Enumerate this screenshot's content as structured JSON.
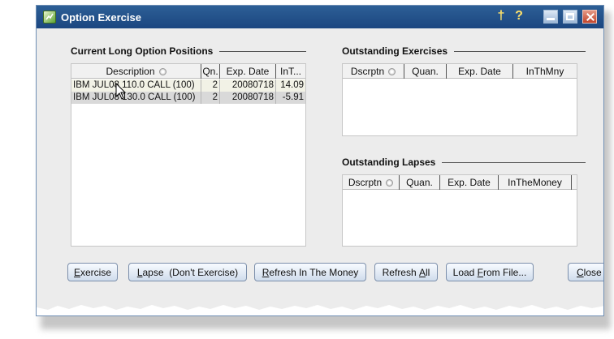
{
  "window": {
    "title": "Option Exercise"
  },
  "titlebar": {
    "pin_glyph": "†",
    "help_glyph": "?"
  },
  "long_positions": {
    "title": "Current Long Option Positions",
    "columns": [
      "Description",
      "Qn.",
      "Exp. Date",
      "InT..."
    ],
    "rows": [
      {
        "description": "IBM JUL08 110.0 CALL (100)",
        "qty": "2",
        "exp_date": "20080718",
        "in_the_money": "14.09"
      },
      {
        "description": "IBM JUL08 130.0 CALL (100)",
        "qty": "2",
        "exp_date": "20080718",
        "in_the_money": "-5.91"
      }
    ]
  },
  "outstanding_exercises": {
    "title": "Outstanding Exercises",
    "columns": [
      "Dscrptn",
      "Quan.",
      "Exp. Date",
      "InThMny"
    ]
  },
  "outstanding_lapses": {
    "title": "Outstanding Lapses",
    "columns": [
      "Dscrptn",
      "Quan.",
      "Exp. Date",
      "InTheMoney"
    ]
  },
  "buttons": {
    "exercise": {
      "mnemonic": "E",
      "rest": "xercise"
    },
    "lapse": {
      "mnemonic": "L",
      "rest": "apse  (Don't Exercise)"
    },
    "refresh_money": {
      "mnemonic": "R",
      "rest": "efresh In The Money"
    },
    "refresh_all": {
      "pre": "Refresh ",
      "mnemonic": "A",
      "rest": "ll"
    },
    "load_file": {
      "pre": "Load ",
      "mnemonic": "F",
      "rest": "rom File..."
    },
    "close": {
      "mnemonic": "C",
      "rest": "lose"
    }
  },
  "colors": {
    "titlebar": "#1f4f88",
    "selected_row": "#d9d9d9",
    "dialog_bg": "#ececec"
  }
}
